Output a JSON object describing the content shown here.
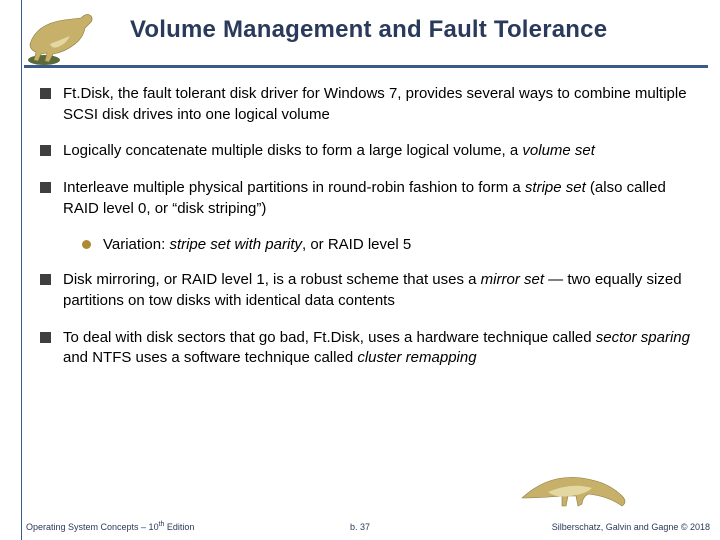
{
  "title": "Volume Management and Fault Tolerance",
  "bullets": {
    "b1": "Ft.Disk, the fault tolerant disk driver for Windows 7, provides several ways to combine multiple SCSI disk drives into one logical volume",
    "b2_pre": "Logically concatenate multiple disks to form a large logical volume, a ",
    "b2_term": "volume set",
    "b3_pre": "Interleave multiple physical partitions in round-robin fashion to form a ",
    "b3_term": "stripe set",
    "b3_post": " (also called RAID level 0, or “disk striping”)",
    "b3_sub_pre": "Variation: ",
    "b3_sub_term": "stripe set with parity",
    "b3_sub_post": ", or RAID level 5",
    "b4_pre": "Disk mirroring, or RAID level 1, is a robust scheme that uses a ",
    "b4_term": "mirror set",
    "b4_post": " — two equally sized partitions on tow disks with identical data contents",
    "b5_pre": "To deal with disk sectors that go bad, Ft.Disk, uses a hardware technique called ",
    "b5_term1": "sector sparing",
    "b5_mid": " and NTFS uses a software technique called ",
    "b5_term2": "cluster remapping"
  },
  "footer": {
    "left_pre": "Operating System Concepts – 10",
    "left_sup": "th",
    "left_post": " Edition",
    "center": "b. 37",
    "right": "Silberschatz, Galvin and Gagne © 2018"
  },
  "icons": {
    "dino_top": "dinosaur-icon",
    "dino_bottom": "dinosaur-tail-icon"
  }
}
